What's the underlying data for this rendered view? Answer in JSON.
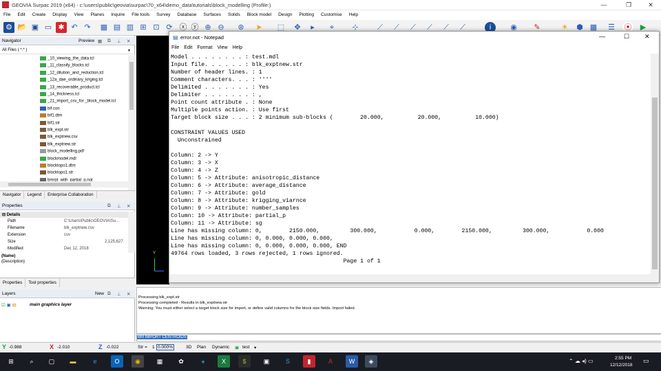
{
  "window": {
    "title": "GEOVIA Surpac 2019 (x64) - c:\\users\\public\\geovia\\surpac\\70_x64\\demo_data\\tutorials\\block_modelling (Profile:)",
    "controls": [
      "—",
      "❐",
      "✕"
    ]
  },
  "menu": [
    "File",
    "Edit",
    "Create",
    "Display",
    "View",
    "Planes",
    "Inquire",
    "File tools",
    "Survey",
    "Database",
    "Surfaces",
    "Solids",
    "Block model",
    "Design",
    "Plotting",
    "Customise",
    "Help"
  ],
  "navigator": {
    "title": "Navigator",
    "preview_label": "Preview",
    "filter": "All Files ( *.* )",
    "items": [
      {
        "name": "_10_viewing_the_data.tcl",
        "kind": "tcl"
      },
      {
        "name": "_11_classify_blocks.tcl",
        "kind": "tcl"
      },
      {
        "name": "_12_dilution_and_reduction.tcl",
        "kind": "tcl"
      },
      {
        "name": "_12a_dae_ordinary_kriging.tcl",
        "kind": "tcl"
      },
      {
        "name": "_13_recoverable_product.tcl",
        "kind": "tcl"
      },
      {
        "name": "_14_thickness.tcl",
        "kind": "tcl"
      },
      {
        "name": "_21_import_csv_for _block_model.tcl",
        "kind": "tcl"
      },
      {
        "name": "bif.con",
        "kind": "con"
      },
      {
        "name": "bif1.dtm",
        "kind": "dtm"
      },
      {
        "name": "bif1.str",
        "kind": "str"
      },
      {
        "name": "blk_expt.str",
        "kind": "str"
      },
      {
        "name": "blk_exptnew.csv",
        "kind": "csv"
      },
      {
        "name": "blk_exptnew.str",
        "kind": "str"
      },
      {
        "name": "block_modelling.pdf",
        "kind": "pdf"
      },
      {
        "name": "blockmodel.mdl",
        "kind": "mdl"
      },
      {
        "name": "blocktopo1.dtm",
        "kind": "dtm"
      },
      {
        "name": "blocktopo1.str",
        "kind": "str"
      },
      {
        "name": "bmrpt_with_partial_p.not",
        "kind": "not"
      }
    ],
    "tabs": [
      "Navigator",
      "Legend",
      "Enterprise Collaboration"
    ]
  },
  "properties": {
    "title": "Properties",
    "section": "Details",
    "rows": [
      {
        "key": "Path",
        "value": "C:\\Users\\Public\\GEOVIA\\Su..."
      },
      {
        "key": "Filename",
        "value": "blk_exptnew.csv"
      },
      {
        "key": "Extension",
        "value": "csv"
      },
      {
        "key": "Size",
        "value": "2,125,627"
      },
      {
        "key": "Modified",
        "value": "Dec 12, 2018"
      }
    ],
    "name_label": "(Name)",
    "desc_label": "(Description)",
    "tabs": [
      "Properties",
      "Tool properties"
    ]
  },
  "layers": {
    "title": "Layers",
    "new_label": "New",
    "layer": "main graphics layer"
  },
  "notepad": {
    "title": "error.not - Notepad",
    "menu": [
      "File",
      "Edit",
      "Format",
      "View",
      "Help"
    ],
    "lines": [
      "Model . . . . . . . . : test.mdl",
      "Input file. . . . . . : blk_exptnew.str",
      "Number of header lines. : 1",
      "Comment characters. . . : ''''",
      "Delimited . . . . . . . : Yes",
      "Delimiter . . . . . . . : ,",
      "Point count attribute . : None",
      "Multiple points action. : Use first",
      "Target block size . . . : 2 minimum sub-blocks (        20.000,          20.000,          10.000)",
      "",
      "CONSTRAINT VALUES USED",
      "  Unconstrained",
      "",
      "Column: 2 -> Y",
      "Column: 3 -> X",
      "Column: 4 -> Z",
      "Column: 5 -> Attribute: anisotropic_distance",
      "Column: 6 -> Attribute: average_distance",
      "Column: 7 -> Attribute: gold",
      "Column: 8 -> Attribute: krigging_viarnce",
      "Column: 9 -> Attribute: number_samples",
      "Column: 10 -> Attribute: partial_p",
      "Column: 11 -> Attribute: sg",
      "Line has missing column: 0,        2150.000,         300.000,           0.000,        2150.000,         300.000,           0.000",
      "Line has missing column: 0, 0.000, 0.000, 0.000,",
      "Line has missing column: 0, 0.000, 0.000, 0.000, END",
      "49764 rows loaded, 3 rows rejected, 1 rows ignored.",
      "                                                   Page 1 of 1"
    ]
  },
  "output": [
    "Processing blk_expt.str",
    "Processing completed - Results in blk_exptnew.str",
    "Warning: You must either select a target block size for import, or define valid columns for the block size fields.  Import failed."
  ],
  "command": "BM IMPORT CENTROIDS",
  "status": {
    "y": "-0.988",
    "x": "-2.010",
    "z": "-0.022",
    "str_label": "Str =",
    "str_value": "1",
    "pct": "0.000%",
    "mode3d": "3D",
    "plan": "Plan",
    "dynamic": "Dynamic",
    "test": "test"
  },
  "taskbar": {
    "time": "2:55 PM",
    "date": "12/12/2018"
  },
  "colors": {
    "accent": "#3370c6",
    "logo": "#c0262d",
    "taskbar": "#1a1c24"
  }
}
